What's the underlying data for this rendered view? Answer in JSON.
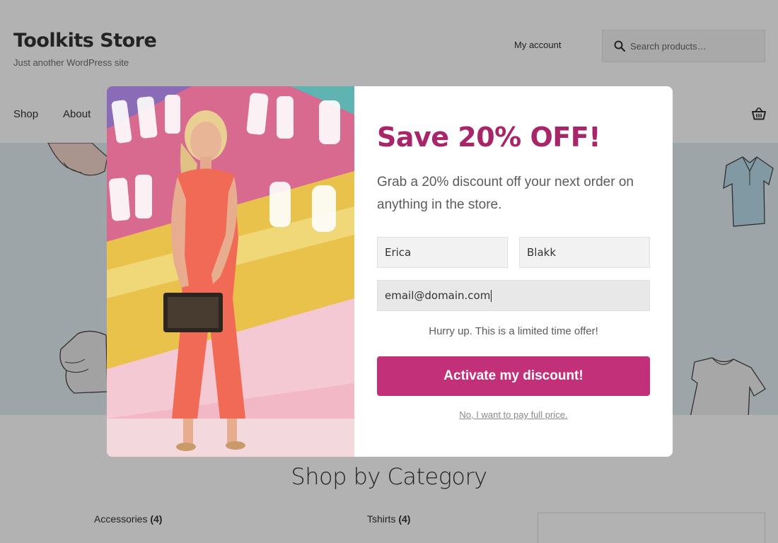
{
  "site": {
    "title": "Toolkits Store",
    "tagline": "Just another WordPress site",
    "my_account": "My account",
    "search_placeholder": "Search products…"
  },
  "nav": {
    "items": [
      "Shop",
      "About"
    ]
  },
  "category_section": {
    "title": "Shop by Category",
    "items": [
      {
        "name": "Accessories",
        "count": "(4)"
      },
      {
        "name": "Tshirts",
        "count": "(4)"
      }
    ]
  },
  "popup": {
    "title": "Save 20% OFF!",
    "description": "Grab a 20% discount off your next order on anything in the store.",
    "first_name_value": "Erica",
    "last_name_value": "Blakk",
    "email_value": "email@domain.com",
    "urgency_text": "Hurry up. This is a limited time offer!",
    "cta_label": "Activate my discount!",
    "decline_label": "No, I want to pay full price."
  },
  "colors": {
    "accent": "#c2307a",
    "title": "#a82569",
    "hero_bg": "#e3edf2",
    "overlay": "rgba(0,0,0,0.3)"
  },
  "icons": {
    "search": "search-icon",
    "cart": "basket-icon"
  }
}
